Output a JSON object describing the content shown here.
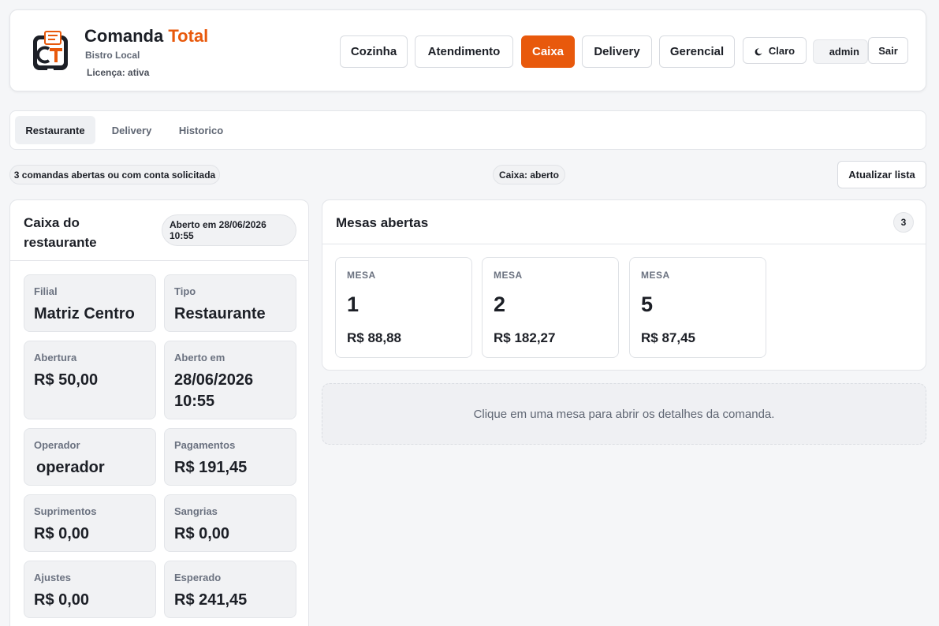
{
  "brand": {
    "name": "Comanda",
    "name_accent": "Total",
    "subtitle": "Bistro Local",
    "license": "Licença: ativa"
  },
  "nav": {
    "items": [
      {
        "label": "Cozinha"
      },
      {
        "label": "Atendimento"
      },
      {
        "label": "Caixa",
        "active": true
      },
      {
        "label": "Delivery"
      },
      {
        "label": "Gerencial"
      }
    ],
    "theme_label": "Claro",
    "theme_icon": "moon-icon",
    "user": "admin",
    "logout_label": "Sair"
  },
  "tabs": [
    {
      "label": "Restaurante",
      "active": true
    },
    {
      "label": "Delivery"
    },
    {
      "label": "Historico"
    }
  ],
  "status": {
    "open_count": "3 comandas abertas ou com conta solicitada",
    "cash_state": "Caixa: aberto",
    "refresh_label": "Atualizar lista"
  },
  "cash": {
    "title": "Caixa do restaurante",
    "opened_badge": "Aberto em 28/06/2026 10:55",
    "stats": [
      {
        "label": "Filial",
        "value": "Matriz Centro"
      },
      {
        "label": "Tipo",
        "value": "Restaurante"
      },
      {
        "label": "Abertura",
        "value": "R$ 50,00"
      },
      {
        "label": "Aberto em",
        "value": "28/06/2026 10:55"
      },
      {
        "label": "Operador",
        "value": "operador"
      },
      {
        "label": "Pagamentos",
        "value": "R$ 191,45"
      },
      {
        "label": "Suprimentos",
        "value": "R$ 0,00"
      },
      {
        "label": "Sangrias",
        "value": "R$ 0,00"
      },
      {
        "label": "Ajustes",
        "value": "R$ 0,00"
      },
      {
        "label": "Esperado",
        "value": "R$ 241,45"
      }
    ]
  },
  "tables": {
    "title": "Mesas abertas",
    "count": "3",
    "items": [
      {
        "label": "MESA",
        "number": "1",
        "total": "R$ 88,88"
      },
      {
        "label": "MESA",
        "number": "2",
        "total": "R$ 182,27"
      },
      {
        "label": "MESA",
        "number": "5",
        "total": "R$ 87,45"
      }
    ]
  },
  "detail_hint": "Clique em uma mesa para abrir os detalhes da comanda.",
  "colors": {
    "accent": "#e8590c",
    "dark": "#1c1f26"
  }
}
